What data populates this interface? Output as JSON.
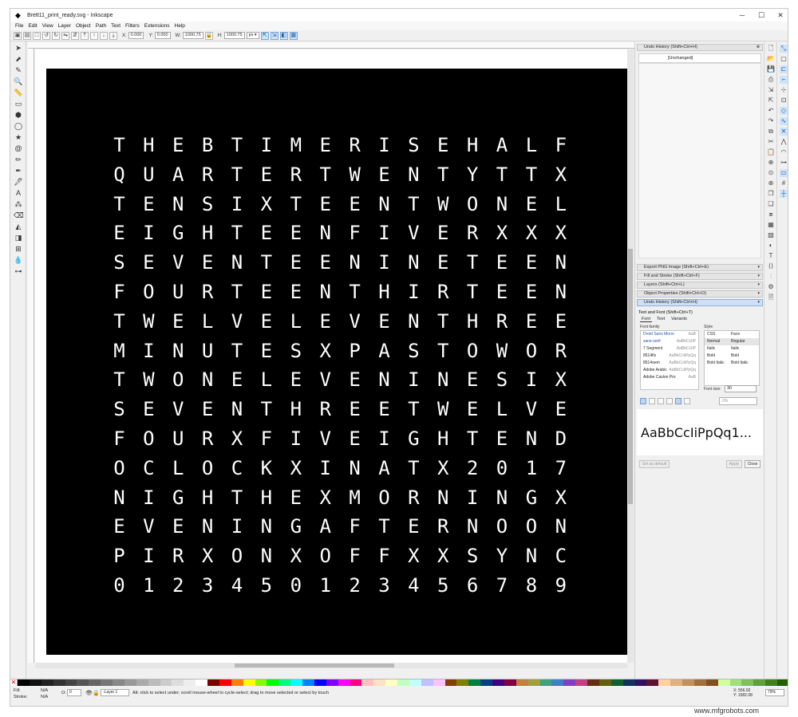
{
  "window": {
    "title": "Brett11_print_ready.svg - Inkscape",
    "minimize": "─",
    "maximize": "☐",
    "close": "✕"
  },
  "menu": [
    "File",
    "Edit",
    "View",
    "Layer",
    "Object",
    "Path",
    "Text",
    "Filters",
    "Extensions",
    "Help"
  ],
  "toolbar": {
    "x_label": "X:",
    "x_value": "0.000",
    "y_label": "Y:",
    "y_value": "0.000",
    "w_label": "W:",
    "w_value": "1000.75",
    "h_label": "H:",
    "h_value": "1000.75",
    "unit": "px ▾"
  },
  "canvas": {
    "rows": [
      "THEBTIMERISEHALF",
      "QUARTERTWENTYTTX",
      "TENSIXTEENTWONEL",
      "EIGHTEENFIVERXXX",
      "SEVENTEENINETEEN",
      "FOURTEENTHIRTEEN",
      "TWELVELEVENTHREE",
      "MINUTESXPASTOWOR",
      "TWONELEVENINESIX",
      "SEVENTHREETWELVE",
      "FOURXFIVEIGHTEND",
      "OCLOCKXINATX2017",
      "NIGHTHEXMORNINGX",
      "EVENINGAFTERNOON",
      "PIRXONXOFFXXSYNC",
      "0123450123456789"
    ]
  },
  "dock": {
    "top_panel_title": "Undo History (Shift+Ctrl+H)",
    "undo_entry": "[Unchanged]",
    "collapsed": [
      "Export PNG Image (Shift+Ctrl+E)",
      "Fill and Stroke (Shift+Ctrl+F)",
      "Layers (Shift+Ctrl+L)",
      "Object Properties (Shift+Ctrl+O)",
      "Undo History (Shift+Ctrl+H)"
    ],
    "text_font": {
      "title": "Text and Font (Shift+Ctrl+T)",
      "tabs": [
        "Font",
        "Text",
        "Variants"
      ],
      "font_family_label": "Font family",
      "style_label": "Style",
      "families": [
        {
          "name": "Droid Sans Mono",
          "sample": "AaB"
        },
        {
          "name": "sans-serif",
          "sample": "AaBbCcIiP"
        },
        {
          "name": "7 Segment",
          "sample": "AaBbCcIiP"
        },
        {
          "name": "8514fix",
          "sample": "AaBbCcIiPpQq"
        },
        {
          "name": "8514oem",
          "sample": "AaBbCcIiPpQq"
        },
        {
          "name": "Adobe Arabic",
          "sample": "AaBbCcIiPpQq"
        },
        {
          "name": "Adobe Caslon Pro",
          "sample": "AaB"
        }
      ],
      "styles": [
        {
          "css": "CSS",
          "face": "Face"
        },
        {
          "css": "Normal",
          "face": "Regular"
        },
        {
          "css": "Italic",
          "face": "Italic"
        },
        {
          "css": "Bold",
          "face": "Bold"
        },
        {
          "css": "Bold Italic",
          "face": "Bold Italic"
        }
      ],
      "font_size_label": "Font size:",
      "font_size": "30",
      "spacing": "0%",
      "preview": "AaBbCcIiPpQq1...",
      "set_default": "Set as default",
      "apply": "Apply",
      "close": "Close"
    }
  },
  "status": {
    "fill_label": "Fill:",
    "stroke_label": "Stroke:",
    "fill_value": "N/A",
    "stroke_value": "N/A",
    "o_label": "O:",
    "o_value": "0",
    "layer": "-Layer 1",
    "message": "Alt: click to select under; scroll mouse-wheel to cycle-select; drag to move selected or select by touch",
    "x": "X: 556.92",
    "y": "Y: 1582.08",
    "zoom": "79%"
  },
  "watermark": "www.mfgrobots.com",
  "colors": {
    "canvas_bg": "#000000",
    "letters": "#ffffff",
    "accent": "#cfe3f7"
  }
}
